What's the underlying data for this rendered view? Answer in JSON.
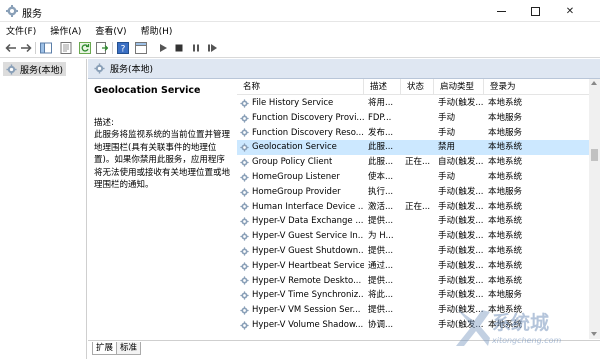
{
  "window": {
    "title": "服务"
  },
  "menu": [
    "文件(F)",
    "操作(A)",
    "查看(V)",
    "帮助(H)"
  ],
  "tree": {
    "item_label": "服务(本地)"
  },
  "right_header": {
    "title": "服务(本地)"
  },
  "description": {
    "service_name": "Geolocation Service",
    "label": "描述:",
    "text": "此服务将监视系统的当前位置并管理地理围栏(具有关联事件的地理位置)。如果你禁用此服务，应用程序将无法使用或接收有关地理位置或地理围栏的通知。"
  },
  "table": {
    "columns": [
      "名称",
      "描述",
      "状态",
      "启动类型",
      "登录为"
    ],
    "rows": [
      {
        "name": "File History Service",
        "desc": "将用...",
        "status": "",
        "start": "手动(触发...",
        "logon": "本地系统"
      },
      {
        "name": "Function Discovery Provi...",
        "desc": "FDP...",
        "status": "",
        "start": "手动",
        "logon": "本地服务"
      },
      {
        "name": "Function Discovery Reso...",
        "desc": "发布...",
        "status": "",
        "start": "手动",
        "logon": "本地服务"
      },
      {
        "name": "Geolocation Service",
        "desc": "此服...",
        "status": "",
        "start": "禁用",
        "logon": "本地系统",
        "selected": true
      },
      {
        "name": "Group Policy Client",
        "desc": "此服...",
        "status": "正在...",
        "start": "自动(触发...",
        "logon": "本地系统"
      },
      {
        "name": "HomeGroup Listener",
        "desc": "使本...",
        "status": "",
        "start": "手动",
        "logon": "本地系统"
      },
      {
        "name": "HomeGroup Provider",
        "desc": "执行...",
        "status": "",
        "start": "手动(触发...",
        "logon": "本地服务"
      },
      {
        "name": "Human Interface Device ...",
        "desc": "激活...",
        "status": "正在...",
        "start": "手动(触发...",
        "logon": "本地系统"
      },
      {
        "name": "Hyper-V Data Exchange ...",
        "desc": "提供...",
        "status": "",
        "start": "手动(触发...",
        "logon": "本地系统"
      },
      {
        "name": "Hyper-V Guest Service In...",
        "desc": "为 H...",
        "status": "",
        "start": "手动(触发...",
        "logon": "本地系统"
      },
      {
        "name": "Hyper-V Guest Shutdown...",
        "desc": "提供...",
        "status": "",
        "start": "手动(触发...",
        "logon": "本地系统"
      },
      {
        "name": "Hyper-V Heartbeat Service",
        "desc": "通过...",
        "status": "",
        "start": "手动(触发...",
        "logon": "本地系统"
      },
      {
        "name": "Hyper-V Remote Deskto...",
        "desc": "提供...",
        "status": "",
        "start": "手动(触发...",
        "logon": "本地系统"
      },
      {
        "name": "Hyper-V Time Synchroniz...",
        "desc": "将此...",
        "status": "",
        "start": "手动(触发...",
        "logon": "本地服务"
      },
      {
        "name": "Hyper-V VM Session Ser...",
        "desc": "提供...",
        "status": "",
        "start": "手动(触发...",
        "logon": "本地系统"
      },
      {
        "name": "Hyper-V Volume Shadow...",
        "desc": "协调...",
        "status": "",
        "start": "手动(触发...",
        "logon": "本地系统"
      }
    ]
  },
  "tabs": [
    "扩展",
    "标准"
  ],
  "watermark": {
    "brand": "系统城",
    "domain": "xitongcheng.com"
  },
  "colors": {
    "selection": "#cce8ff",
    "header_bg": "#dfe7f2",
    "close_red": "#e81123"
  },
  "icons": [
    "services-app-icon",
    "back-arrow-icon",
    "forward-arrow-icon",
    "console-tree-icon",
    "properties-icon",
    "refresh-icon",
    "export-list-icon",
    "help-icon",
    "show-hide-icon",
    "play-icon",
    "stop-icon",
    "pause-icon",
    "restart-icon",
    "gear-icon"
  ]
}
